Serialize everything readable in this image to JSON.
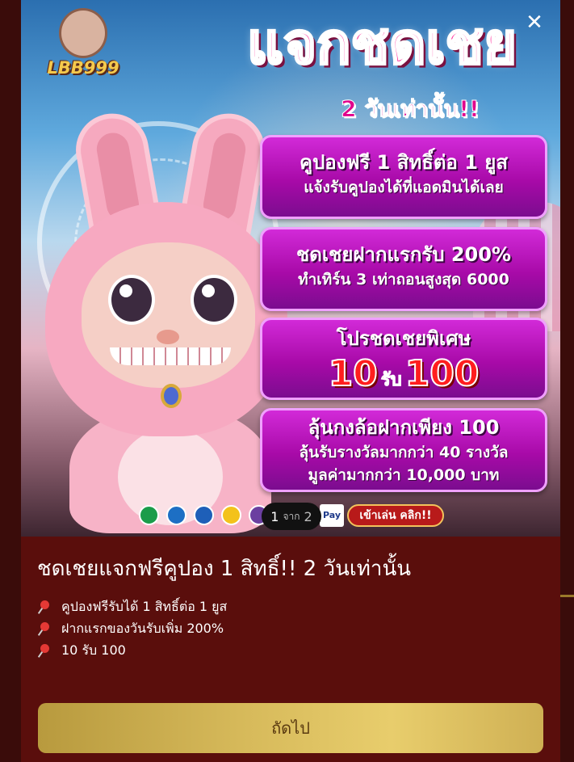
{
  "modal": {
    "close_label": "✕",
    "banner": {
      "logo_text": "LBB999",
      "headline": "แจกชดเชย",
      "subheadline": "2 วันเท่านั้น!!",
      "promos": [
        {
          "title": "คูปองฟรี 1 สิทธิ์ต่อ 1 ยูส",
          "lines": [
            "แจ้งรับคูปองได้ที่แอดมินได้เลย"
          ]
        },
        {
          "title": "ชดเชยฝากแรกรับ 200%",
          "lines": [
            "ทำเทิร์น 3 เท่าถอนสูงสุด 6000"
          ]
        },
        {
          "title": "โปรชดเชยพิเศษ",
          "big_left": "10",
          "big_mid": "รับ",
          "big_right": "100"
        },
        {
          "title": "ลุ้นกงล้อฝากเพียง 100",
          "lines": [
            "ลุ้นรับรางวัลมากกว่า 40 รางวัล",
            "มูลค่ามากกว่า 10,000 บาท"
          ]
        }
      ],
      "pay_badge": "Pay",
      "play_button": "เข้าเล่น คลิก!!",
      "bank_colors": [
        "#1b9c4a",
        "#1d6fc4",
        "#1e5fb8",
        "#f3c21a",
        "#6b3fa0"
      ]
    },
    "pager": {
      "current": "1",
      "of": "จาก",
      "total": "2"
    },
    "title": "ชดเชยแจกฟรีคูปอง 1 สิทธิ์!! 2 วันเท่านั้น",
    "bullets": [
      "คูปองฟรีรับได้ 1 สิทธิ์ต่อ 1 ยูส",
      "ฝากแรกของวันรับเพิ่ม 200%",
      "10 รับ 100"
    ],
    "bullet_icon": "pushpin-icon",
    "next_button": "ถัดไป"
  },
  "colors": {
    "modal_bg": "#5a0e0c",
    "button_gold": "#d6b95a",
    "promo_purple": "#b61ab8",
    "headline_pink": "#ff3aa0"
  }
}
